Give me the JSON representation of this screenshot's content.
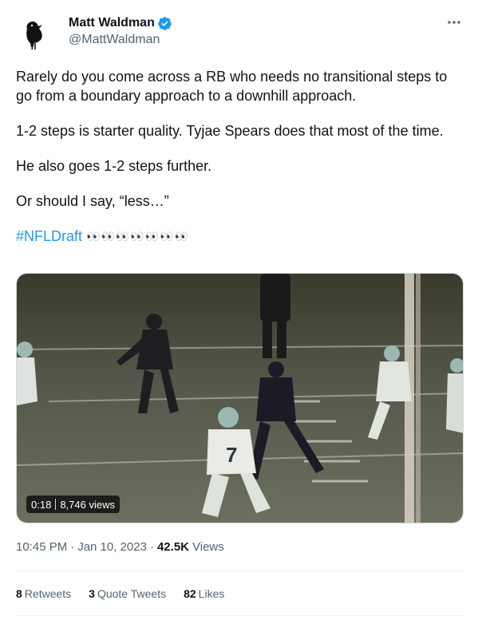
{
  "author": {
    "display_name": "Matt Waldman",
    "handle": "@MattWaldman",
    "avatar_icon": "crow-avatar-icon",
    "verified_color": "#1d9bf0"
  },
  "tweet": {
    "paragraphs": [
      "Rarely do you come across a RB who needs no transitional steps to go from a boundary approach to a downhill approach.",
      "1-2 steps is starter quality. Tyjae Spears does that most of the time.",
      "He also goes 1-2 steps further.",
      "Or should I say, “less…”"
    ],
    "hashtag": "#NFLDraft",
    "emoji": "👀👀👀👀👀👀👀"
  },
  "media": {
    "duration": "0:18",
    "views": "8,746 views"
  },
  "meta": {
    "time": "10:45 PM",
    "date": "Jan 10, 2023",
    "separator": "·",
    "views_count": "42.5K",
    "views_label": "Views"
  },
  "stats": {
    "retweets_count": "8",
    "retweets_label": "Retweets",
    "quote_count": "3",
    "quote_label": "Quote Tweets",
    "likes_count": "82",
    "likes_label": "Likes"
  },
  "colors": {
    "accent": "#1d9bf0",
    "secondary_text": "#536471",
    "primary_text": "#0f1419"
  }
}
